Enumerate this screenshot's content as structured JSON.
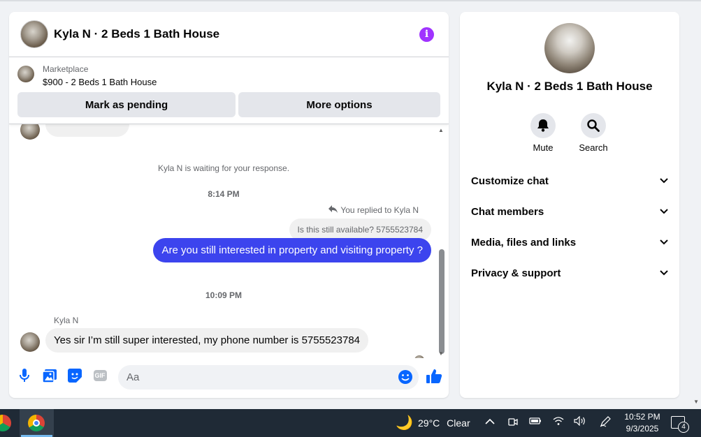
{
  "header": {
    "title": "Kyla N · 2 Beds 1 Bath House",
    "info_icon": "info-icon"
  },
  "listing": {
    "label": "Marketplace",
    "price_title": "$900 - 2 Beds 1 Bath House",
    "mark_pending": "Mark as pending",
    "more_options": "More options"
  },
  "messages": {
    "waiting_notice": "Kyla N is waiting for your response.",
    "time1": "8:14 PM",
    "replied_note": "You replied to Kyla N",
    "quoted_text": "Is this still available? 5755523784",
    "outgoing": "Are you still interested in property and visiting property ?",
    "time2": "10:09 PM",
    "sender_name": "Kyla N",
    "incoming": "Yes sir I’m still super interested, my phone number is 5755523784"
  },
  "composer": {
    "placeholder": "Aa",
    "gif_label": "GIF",
    "icons": [
      "microphone-icon",
      "photo-icon",
      "sticker-icon",
      "gif-icon",
      "emoji-icon",
      "like-icon"
    ]
  },
  "info_panel": {
    "title": "Kyla N · 2 Beds 1 Bath House",
    "actions": [
      {
        "label": "Mute",
        "icon": "bell-icon"
      },
      {
        "label": "Search",
        "icon": "search-icon"
      }
    ],
    "sections": [
      {
        "label": "Customize chat"
      },
      {
        "label": "Chat members"
      },
      {
        "label": "Media, files and links"
      },
      {
        "label": "Privacy & support"
      }
    ]
  },
  "taskbar": {
    "temperature": "29°C",
    "weather": "Clear",
    "time": "10:52 PM",
    "date": "9/3/2025",
    "notification_count": "4"
  },
  "colors": {
    "accent": "#3c44ee",
    "info": "#a033ff",
    "messenger_blue": "#0866ff",
    "taskbar": "#1f2a36"
  }
}
